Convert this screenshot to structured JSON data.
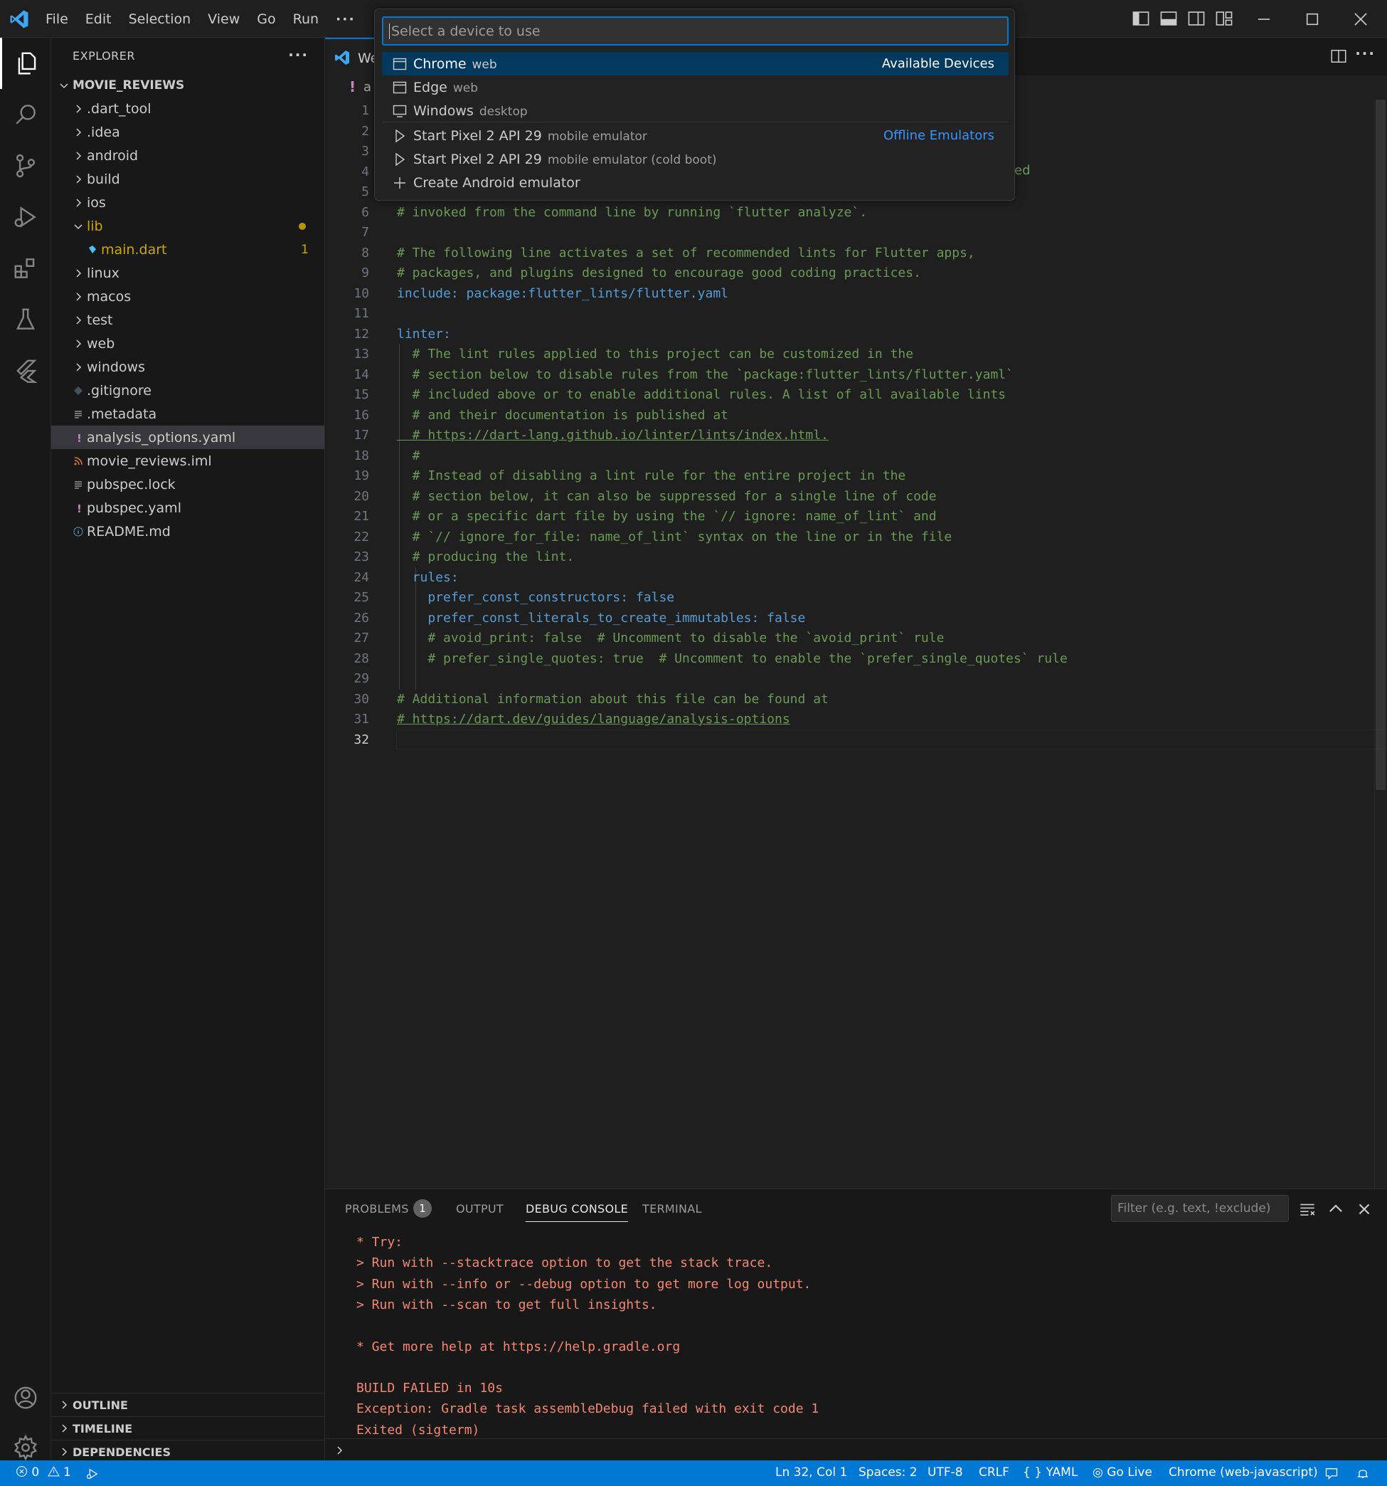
{
  "menu": [
    "File",
    "Edit",
    "Selection",
    "View",
    "Go",
    "Run"
  ],
  "menu_more": "···",
  "sidebar": {
    "title": "EXPLORER",
    "more": "···",
    "root": "MOVIE_REVIEWS",
    "items": [
      {
        "label": ".dart_tool",
        "type": "folder"
      },
      {
        "label": ".idea",
        "type": "folder"
      },
      {
        "label": "android",
        "type": "folder"
      },
      {
        "label": "build",
        "type": "folder"
      },
      {
        "label": "ios",
        "type": "folder"
      },
      {
        "label": "lib",
        "type": "folder-open"
      },
      {
        "label": "main.dart",
        "type": "file",
        "badge": "1"
      },
      {
        "label": "linux",
        "type": "folder"
      },
      {
        "label": "macos",
        "type": "folder"
      },
      {
        "label": "test",
        "type": "folder"
      },
      {
        "label": "web",
        "type": "folder"
      },
      {
        "label": "windows",
        "type": "folder"
      },
      {
        "label": ".gitignore",
        "type": "file"
      },
      {
        "label": ".metadata",
        "type": "file"
      },
      {
        "label": "analysis_options.yaml",
        "type": "file"
      },
      {
        "label": "movie_reviews.iml",
        "type": "file"
      },
      {
        "label": "pubspec.lock",
        "type": "file"
      },
      {
        "label": "pubspec.yaml",
        "type": "file"
      },
      {
        "label": "README.md",
        "type": "file"
      }
    ],
    "sections": [
      "OUTLINE",
      "TIMELINE",
      "DEPENDENCIES"
    ]
  },
  "tabs": {
    "active_label": "We"
  },
  "breadcrumb": {
    "label": "a"
  },
  "quickpick": {
    "placeholder": "Select a device to use",
    "rows": [
      {
        "label": "Chrome",
        "desc": "web",
        "sep": "Available Devices",
        "icon": "browser-icon"
      },
      {
        "label": "Edge",
        "desc": "web",
        "sep": "",
        "icon": "browser-icon"
      },
      {
        "label": "Windows",
        "desc": "desktop",
        "sep": "",
        "icon": "desktop-icon"
      },
      {
        "label": "Start Pixel 2 API 29",
        "desc": "mobile emulator",
        "sep": "Offline Emulators",
        "icon": "play-icon"
      },
      {
        "label": "Start Pixel 2 API 29",
        "desc": "mobile emulator (cold boot)",
        "sep": "",
        "icon": "play-icon"
      },
      {
        "label": "Create Android emulator",
        "desc": "",
        "sep": "",
        "icon": "add-icon"
      }
    ]
  },
  "editor": {
    "visible_fragment_line4": "led",
    "lines": [
      "",
      "",
      "",
      "",
      "",
      "# invoked from the command line by running `flutter analyze`.",
      "",
      "# The following line activates a set of recommended lints for Flutter apps,",
      "# packages, and plugins designed to encourage good coding practices.",
      "include: package:flutter_lints/flutter.yaml",
      "",
      "linter:",
      "  # The lint rules applied to this project can be customized in the",
      "  # section below to disable rules from the `package:flutter_lints/flutter.yaml`",
      "  # included above or to enable additional rules. A list of all available lints",
      "  # and their documentation is published at",
      "  # https://dart-lang.github.io/linter/lints/index.html.",
      "  #",
      "  # Instead of disabling a lint rule for the entire project in the",
      "  # section below, it can also be suppressed for a single line of code",
      "  # or a specific dart file by using the `// ignore: name_of_lint` and",
      "  # `// ignore_for_file: name_of_lint` syntax on the line or in the file",
      "  # producing the lint.",
      "  rules:",
      "    prefer_const_constructors: false",
      "    prefer_const_literals_to_create_immutables: false",
      "    # avoid_print: false  # Uncomment to disable the `avoid_print` rule",
      "    # prefer_single_quotes: true  # Uncomment to enable the `prefer_single_quotes` rule",
      "",
      "# Additional information about this file can be found at",
      "# https://dart.dev/guides/language/analysis-options",
      ""
    ]
  },
  "panel": {
    "tabs": [
      "PROBLEMS",
      "OUTPUT",
      "DEBUG CONSOLE",
      "TERMINAL"
    ],
    "problems_count": "1",
    "active_tab": "DEBUG CONSOLE",
    "filter_placeholder": "Filter (e.g. text, !exclude)",
    "console": [
      "* Try:",
      "> Run with --stacktrace option to get the stack trace.",
      "> Run with --info or --debug option to get more log output.",
      "> Run with --scan to get full insights.",
      "",
      "* Get more help at https://help.gradle.org",
      "",
      "BUILD FAILED in 10s",
      "Exception: Gradle task assembleDebug failed with exit code 1",
      "Exited (sigterm)"
    ]
  },
  "status": {
    "errors": "0",
    "warnings": "1",
    "position": "Ln 32, Col 1",
    "spaces": "Spaces: 2",
    "encoding": "UTF-8",
    "eol": "CRLF",
    "language": "YAML",
    "live": "Go Live",
    "device": "Chrome (web-javascript)"
  },
  "colors": {
    "accent": "#0078d4",
    "status_bg": "#0078d4",
    "error_text": "#f48771",
    "comment": "#6a9955",
    "keyword": "#569cd6"
  }
}
